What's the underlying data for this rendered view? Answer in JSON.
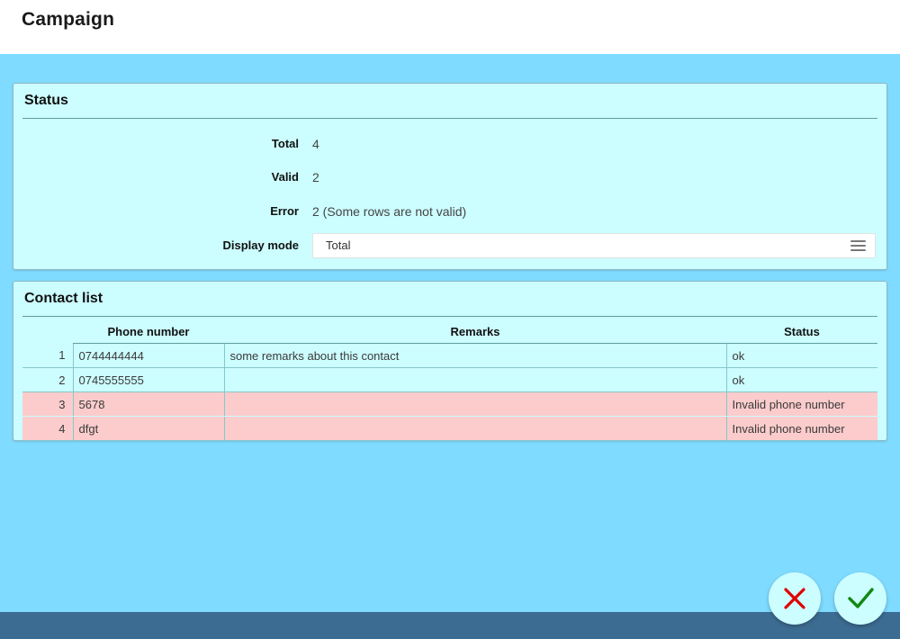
{
  "header": {
    "title": "Campaign"
  },
  "status_panel": {
    "title": "Status",
    "fields": [
      {
        "label": "Total",
        "value": "4"
      },
      {
        "label": "Valid",
        "value": "2"
      },
      {
        "label": "Error",
        "value": "2 (Some rows are not valid)"
      }
    ],
    "display_mode": {
      "label": "Display mode",
      "value": "Total",
      "icon": "list-lines-icon"
    }
  },
  "contacts_panel": {
    "title": "Contact list",
    "columns": [
      "",
      "Phone number",
      "Remarks",
      "Status"
    ],
    "rows": [
      {
        "index": "1",
        "phone": "0744444444",
        "remarks": "some remarks about this contact",
        "status": "ok",
        "error": false
      },
      {
        "index": "2",
        "phone": "0745555555",
        "remarks": "",
        "status": "ok",
        "error": false
      },
      {
        "index": "3",
        "phone": "5678",
        "remarks": "",
        "status": "Invalid phone number",
        "error": true
      },
      {
        "index": "4",
        "phone": "dfgt",
        "remarks": "",
        "status": "Invalid phone number",
        "error": true
      }
    ]
  },
  "actions": {
    "cancel": {
      "name": "cancel-button",
      "icon": "close-x-icon",
      "color": "#e00000"
    },
    "confirm": {
      "name": "confirm-button",
      "icon": "checkmark-icon",
      "color": "#118811"
    }
  },
  "colors": {
    "page_background": "#7fdbff",
    "panel_background": "#ccfdff",
    "footer": "#3d6c92",
    "error_row": "#fccccc",
    "rule": "#5f9ea0"
  }
}
